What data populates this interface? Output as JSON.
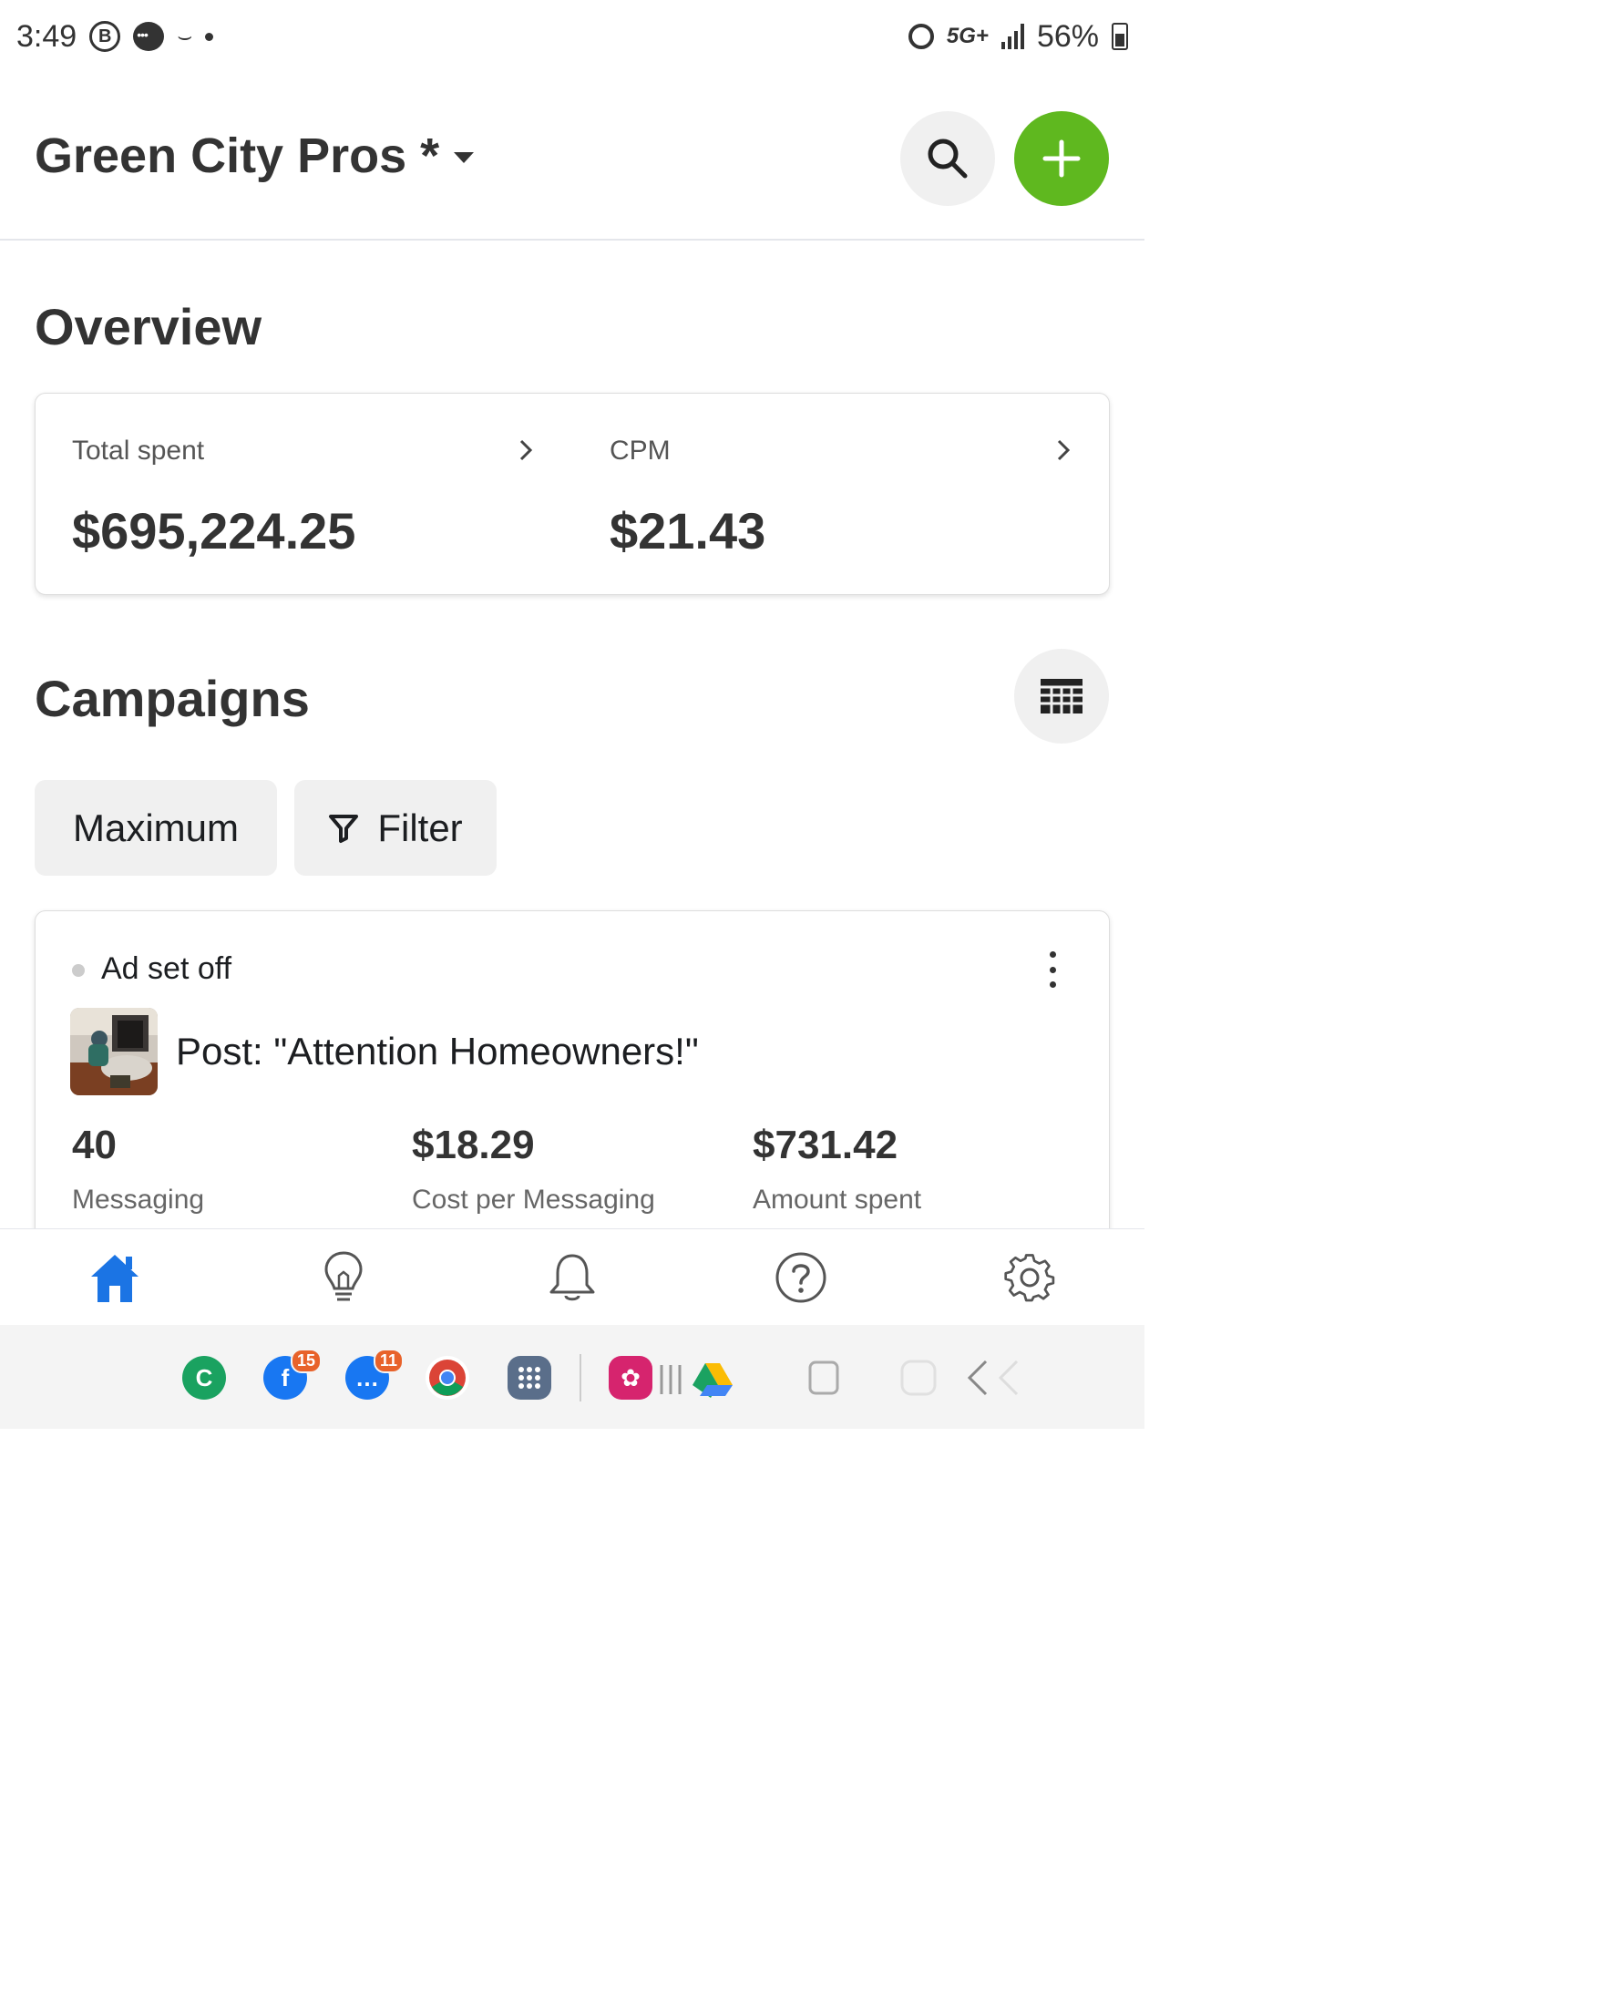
{
  "status_bar": {
    "time": "3:49",
    "b_badge": "B",
    "network": "5G+",
    "battery": "56%"
  },
  "header": {
    "account_name": "Green City Pros *",
    "icons": [
      "chevron-down-icon",
      "search-icon",
      "plus-icon"
    ],
    "accent_color": "#5fb81f"
  },
  "overview": {
    "title": "Overview",
    "metrics": [
      {
        "label": "Total spent",
        "value": "$695,224.25"
      },
      {
        "label": "CPM",
        "value": "$21.43"
      }
    ]
  },
  "campaigns": {
    "title": "Campaigns",
    "view_toggle_icon": "table-view-icon",
    "date_range_label": "Maximum",
    "filter_label": "Filter",
    "items": [
      {
        "status": "Ad set off",
        "post_title": "Post: \"Attention Homeowners!\"",
        "stats": [
          {
            "value": "40",
            "label": "Messaging"
          },
          {
            "value": "$18.29",
            "label": "Cost per Messaging"
          },
          {
            "value": "$731.42",
            "label": "Amount spent"
          }
        ]
      }
    ]
  },
  "bottom_nav": {
    "items": [
      "home-icon",
      "lightbulb-icon",
      "bell-icon",
      "help-icon",
      "settings-icon"
    ],
    "active": "home-icon",
    "active_color": "#1b74e4"
  },
  "taskbar": {
    "facebook_badge": "15",
    "messenger_badge": "11"
  }
}
